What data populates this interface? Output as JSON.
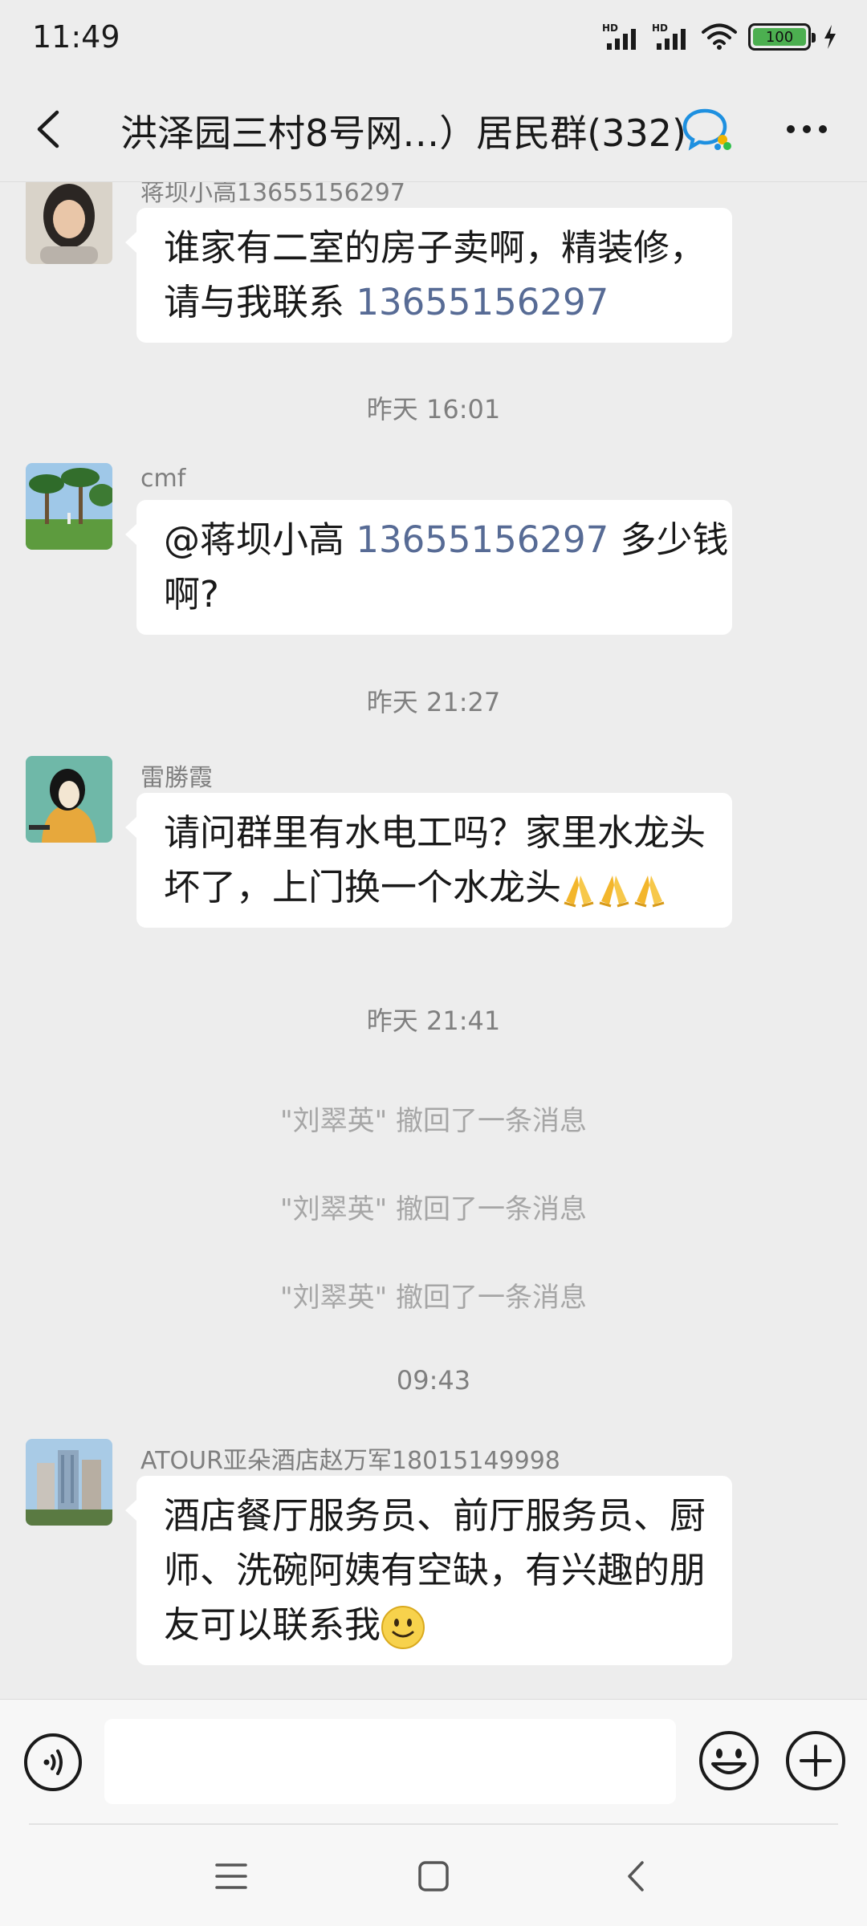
{
  "status_bar": {
    "time": "11:49",
    "signal_label_1": "HD",
    "signal_label_2": "HD",
    "battery_level": "100",
    "battery_fraction": 1.0,
    "battery_color": "#4caf50"
  },
  "header": {
    "title": "洪泽园三村8号网…）居民群(332)",
    "back_icon": "back-arrow-icon",
    "group_icon": "group-chat-icon",
    "more_icon": "more-icon"
  },
  "messages": [
    {
      "sender": "蒋坝小高13655156297",
      "avatar": "avatar-woman",
      "lines": [
        [
          {
            "text": "谁家有二室的房子卖啊，精装修，"
          }
        ],
        [
          {
            "text": "请与我联系 "
          },
          {
            "text": "13655156297",
            "link": true
          }
        ]
      ]
    },
    {
      "timestamp": "昨天 16:01"
    },
    {
      "sender": "cmf",
      "avatar": "avatar-palm-trees",
      "lines": [
        [
          {
            "text": "@蒋坝小高 "
          },
          {
            "text": "13655156297",
            "link": true
          },
          {
            "text": "  多少钱"
          }
        ],
        [
          {
            "text": "啊?"
          }
        ]
      ]
    },
    {
      "timestamp": "昨天 21:27"
    },
    {
      "sender": "雷勝霞",
      "avatar": "avatar-illustration",
      "lines": [
        [
          {
            "text": "请问群里有水电工吗？家里水龙头"
          }
        ],
        [
          {
            "text": "坏了，上门换一个水龙头"
          },
          {
            "emoji": "pray-hands-icon"
          },
          {
            "emoji": "pray-hands-icon"
          },
          {
            "emoji": "pray-hands-icon"
          }
        ]
      ]
    },
    {
      "timestamp": "昨天 21:41"
    },
    {
      "system_notes": [
        "\"刘翠英\" 撤回了一条消息",
        "\"刘翠英\" 撤回了一条消息",
        "\"刘翠英\" 撤回了一条消息"
      ]
    },
    {
      "timestamp": "09:43"
    },
    {
      "sender": "ATOUR亚朵酒店赵万军18015149998",
      "avatar": "avatar-hotel-building",
      "lines": [
        [
          {
            "text": "酒店餐厅服务员、前厅服务员、厨"
          }
        ],
        [
          {
            "text": "师、洗碗阿姨有空缺，有兴趣的朋"
          }
        ],
        [
          {
            "text": "友可以联系我"
          },
          {
            "emoji": "smile-emoji-icon"
          }
        ]
      ]
    }
  ],
  "input_bar": {
    "voice_icon": "voice-input-icon",
    "text_value": "",
    "emoji_icon": "emoji-icon",
    "plus_icon": "plus-icon"
  },
  "nav_bar": {
    "menu_icon": "menu-icon",
    "home_icon": "home-icon",
    "back_icon": "back-icon"
  },
  "colors": {
    "background": "#ededed",
    "bubble": "#ffffff",
    "link": "#576b95",
    "meta_text": "#7f7f7f"
  }
}
